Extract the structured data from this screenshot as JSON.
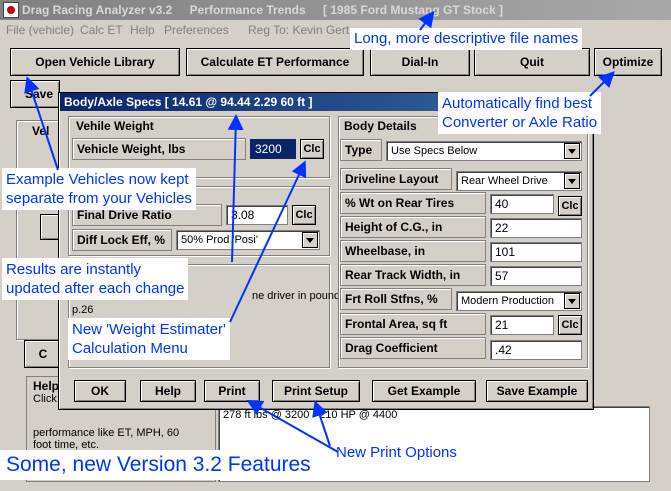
{
  "window": {
    "title_app": "Drag Racing Analyzer v3.2",
    "title_company": "Performance Trends",
    "title_file": "[ 1985 Ford Mustang GT Stock ]"
  },
  "menu": {
    "file": "File (vehicle)",
    "calc": "Calc ET",
    "help": "Help",
    "prefs": "Preferences",
    "reg": "Reg To: Kevin Gert"
  },
  "toolbar": {
    "open_library": "Open Vehicle Library",
    "calc_et": "Calculate ET Performance",
    "dial_in": "Dial-In",
    "quit": "Quit",
    "optimize": "Optimize",
    "save": "Save"
  },
  "background": {
    "veh_frame_label": "Vel",
    "c_button": "C",
    "help_title": "Help",
    "help_text": [
      "Click",
      "performance like ET, MPH, 60",
      "foot time, etc."
    ],
    "engine_text": "ne driver in pounds.",
    "page_ref": "p.26",
    "result_text": "278 ft lbs @ 3200 - 210 HP @ 4400"
  },
  "dialog": {
    "title": "Body/Axle Specs  [ 14.61 @ 94.44   2.29 60 ft ]",
    "weight_section": "Vehile Weight",
    "weight_label": "Vehicle Weight, lbs",
    "weight_value": "3200",
    "final_drive_label": "Final Drive Ratio",
    "final_drive_value": "3.08",
    "diff_lock_label": "Diff Lock Eff, %",
    "diff_lock_value": "50%  Prod 'Posi'",
    "body_section": "Body Details",
    "type_label": "Type",
    "type_value": "Use Specs Below",
    "driveline_label": "Driveline Layout",
    "driveline_value": "Rear Wheel Drive",
    "wt_rear_label": "% Wt on Rear Tires",
    "wt_rear_value": "40",
    "cg_label": "Height of C.G., in",
    "cg_value": "22",
    "wheelbase_label": "Wheelbase, in",
    "wheelbase_value": "101",
    "track_label": "Rear Track Width, in",
    "track_value": "57",
    "roll_label": "Frt Roll Stfns, %",
    "roll_value": "Modern Production",
    "frontal_label": "Frontal Area, sq ft",
    "frontal_value": "21",
    "drag_label": "Drag Coefficient",
    "drag_value": ".42",
    "clc": "Clc",
    "ok": "OK",
    "help": "Help",
    "print": "Print",
    "print_setup": "Print Setup",
    "get_example": "Get Example",
    "save_example": "Save Example"
  },
  "annotations": {
    "file_names": "Long, more descriptive file names",
    "optimize_line1": "Automatically find best",
    "optimize_line2": "Converter or Axle Ratio",
    "examples_line1": "Example Vehicles now kept",
    "examples_line2": "separate from your Vehicles",
    "results_line1": "Results are instantly",
    "results_line2": "updated after each change",
    "weight_line1": "New 'Weight Estimater'",
    "weight_line2": "Calculation Menu",
    "print_options": "New Print Options",
    "features": "Some, new Version 3.2 Features"
  }
}
